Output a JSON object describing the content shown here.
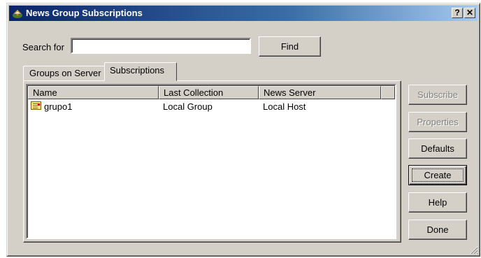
{
  "window": {
    "title": "News Group Subscriptions",
    "help_glyph": "?",
    "close_glyph": "✕"
  },
  "search": {
    "label": "Search for",
    "value": "",
    "find_label": "Find"
  },
  "tabs": [
    {
      "label": "Groups on Server",
      "active": false
    },
    {
      "label": "Subscriptions",
      "active": true
    }
  ],
  "table": {
    "columns": [
      "Name",
      "Last Collection",
      "News Server",
      ""
    ],
    "rows": [
      {
        "name": "grupo1",
        "last_collection": "Local Group",
        "news_server": "Local Host",
        "icon": "newsgroup-icon"
      }
    ]
  },
  "buttons": {
    "subscribe": "Subscribe",
    "properties": "Properties",
    "defaults": "Defaults",
    "create": "Create",
    "help": "Help",
    "done": "Done"
  },
  "colors": {
    "face": "#d4d0c8",
    "title_start": "#0a246a",
    "title_end": "#a6caf0",
    "disabled_text": "#808080"
  }
}
